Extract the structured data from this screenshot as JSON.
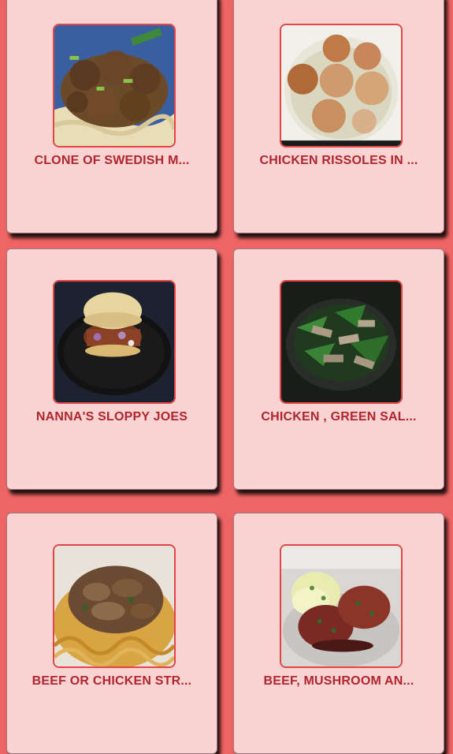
{
  "recipes": [
    {
      "title": "CLONE OF SWEDISH M...",
      "image": "swedish-meatballs-photo"
    },
    {
      "title": "CHICKEN RISSOLES IN ...",
      "image": "chicken-rissoles-photo"
    },
    {
      "title": "NANNA'S SLOPPY JOES",
      "image": "sloppy-joe-photo"
    },
    {
      "title": "CHICKEN , GREEN SAL...",
      "image": "chicken-green-salad-photo"
    },
    {
      "title": "BEEF OR CHICKEN STR...",
      "image": "beef-stroganoff-photo"
    },
    {
      "title": "BEEF, MUSHROOM AN...",
      "image": "beef-patties-photo"
    }
  ]
}
